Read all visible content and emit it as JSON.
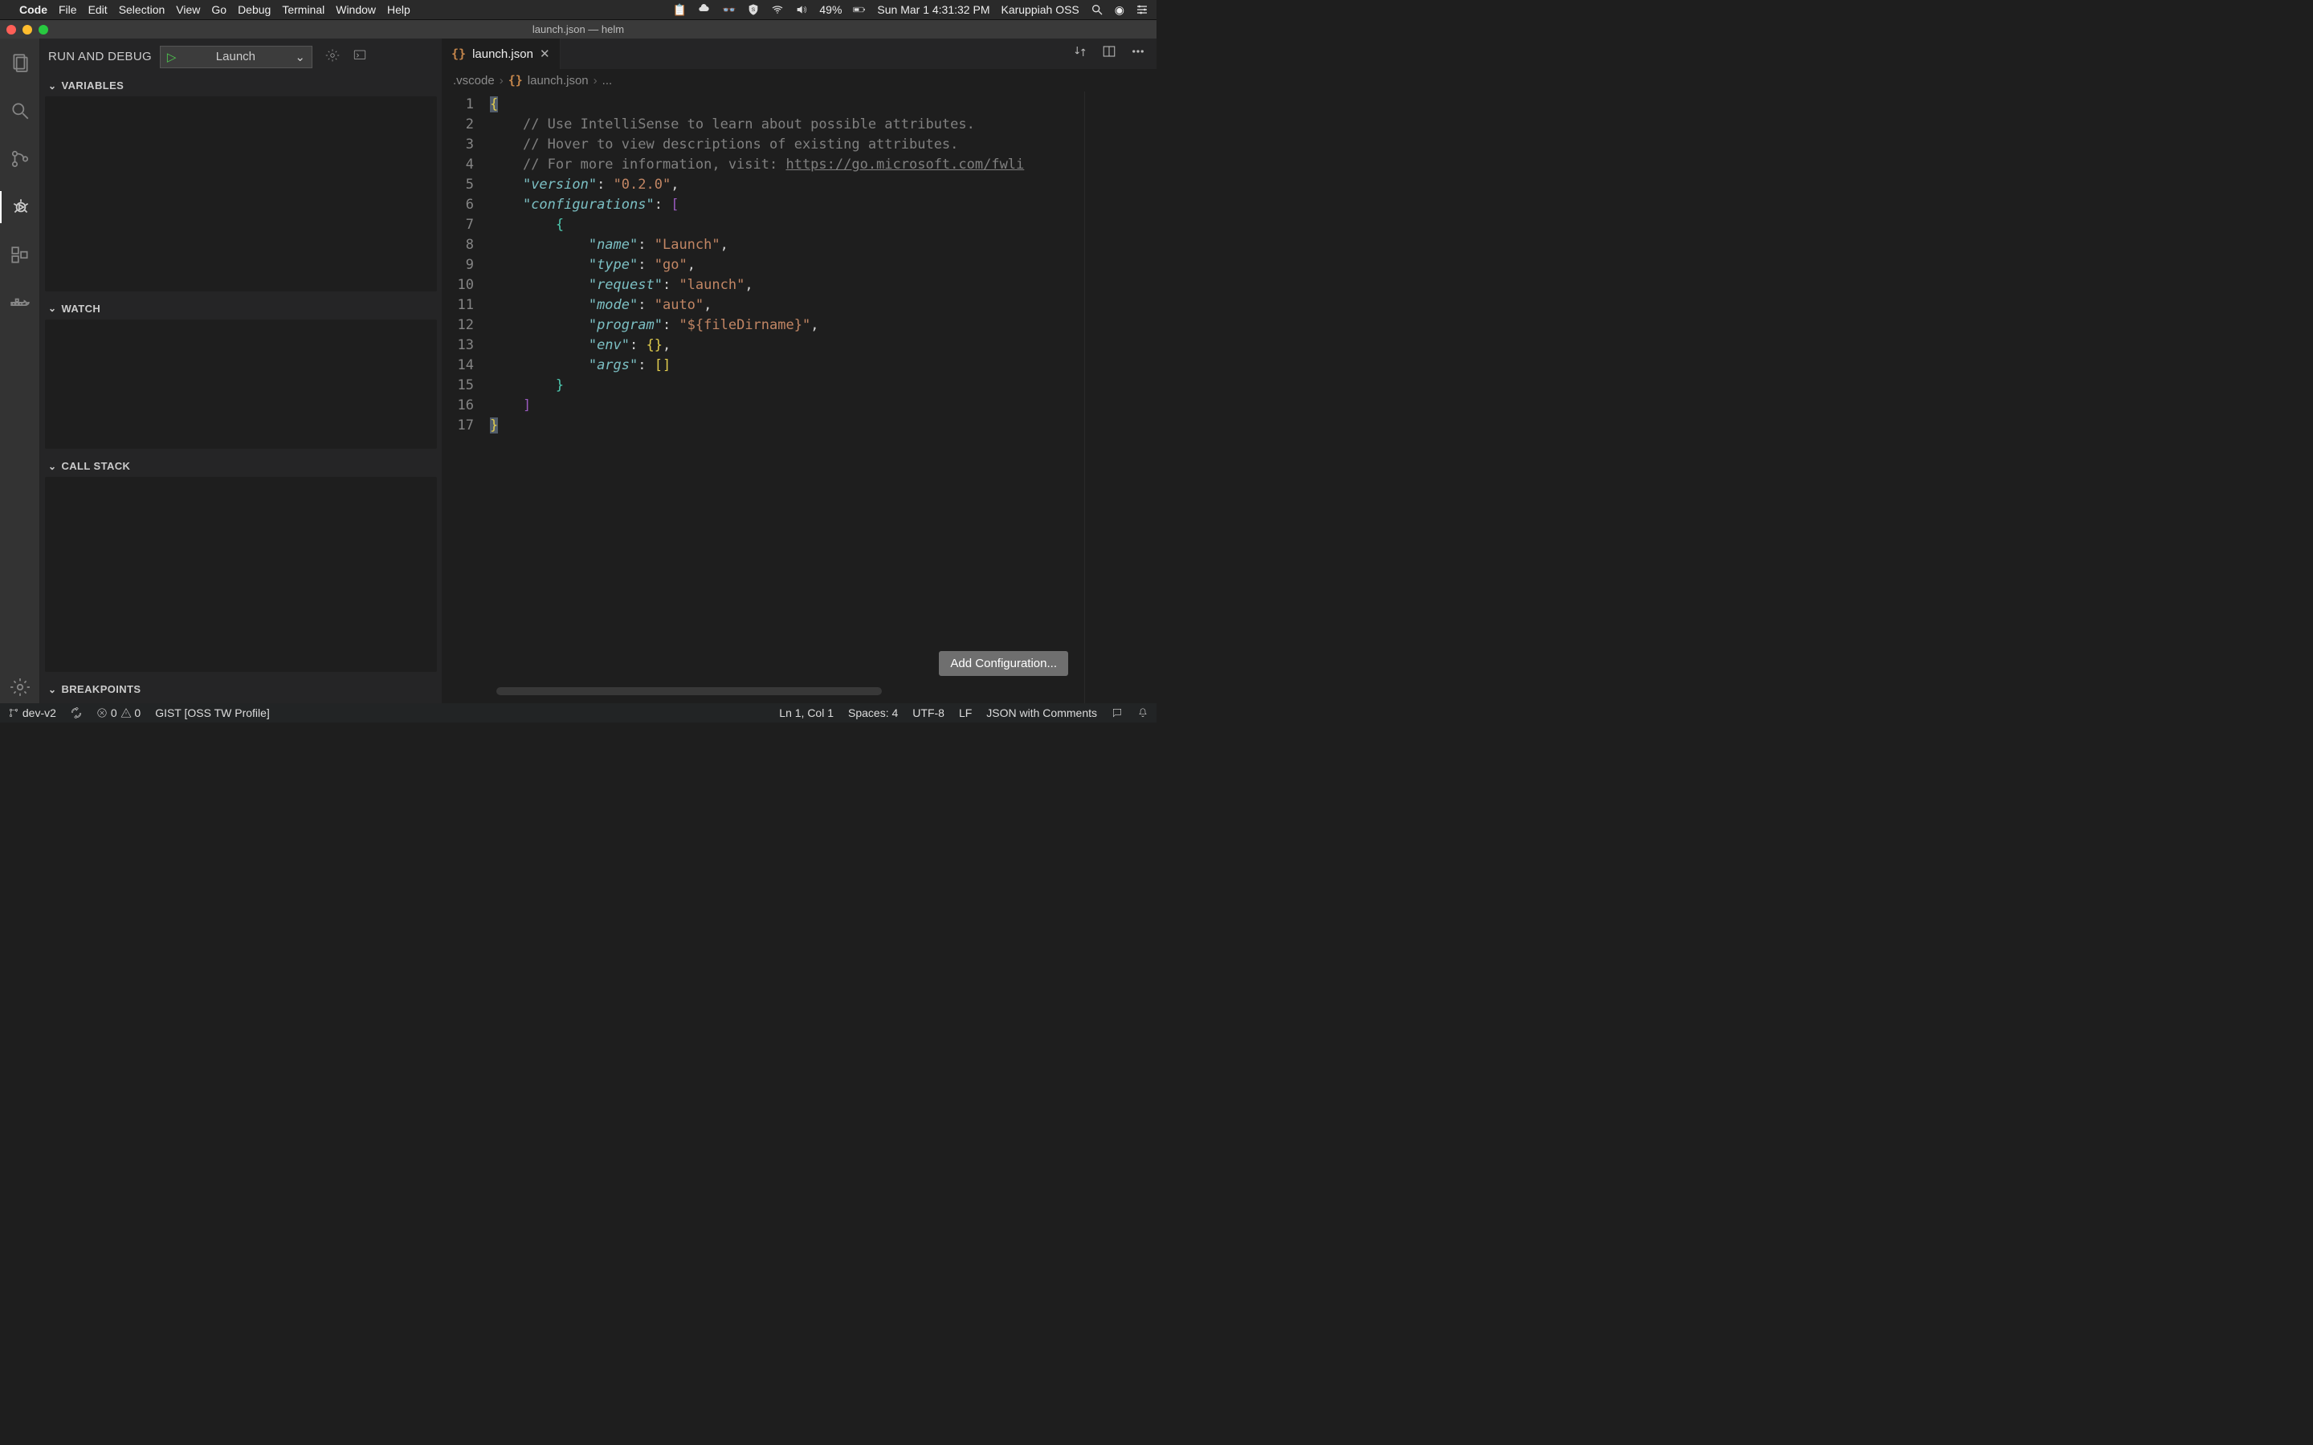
{
  "mac": {
    "appname": "Code",
    "menus": [
      "File",
      "Edit",
      "Selection",
      "View",
      "Go",
      "Debug",
      "Terminal",
      "Window",
      "Help"
    ],
    "battery": "49%",
    "datetime": "Sun Mar 1  4:31:32 PM",
    "user": "Karuppiah OSS"
  },
  "window": {
    "title": "launch.json — helm"
  },
  "sidebar": {
    "title": "RUN AND DEBUG",
    "config_selected": "Launch",
    "sections": {
      "variables": "VARIABLES",
      "watch": "WATCH",
      "callstack": "CALL STACK",
      "breakpoints": "BREAKPOINTS"
    }
  },
  "tab": {
    "filename": "launch.json"
  },
  "breadcrumbs": {
    "folder": ".vscode",
    "file": "launch.json",
    "tail": "..."
  },
  "code": {
    "lines": [
      {
        "n": 1,
        "indent": 0,
        "seg": [
          [
            "brace-hl",
            "{"
          ]
        ]
      },
      {
        "n": 2,
        "indent": 1,
        "seg": [
          [
            "comment",
            "// Use IntelliSense to learn about possible attributes."
          ]
        ]
      },
      {
        "n": 3,
        "indent": 1,
        "seg": [
          [
            "comment",
            "// Hover to view descriptions of existing attributes."
          ]
        ]
      },
      {
        "n": 4,
        "indent": 1,
        "seg": [
          [
            "comment",
            "// For more information, visit: "
          ],
          [
            "link",
            "https://go.microsoft.com/fwli"
          ]
        ]
      },
      {
        "n": 5,
        "indent": 1,
        "seg": [
          [
            "key",
            "\"version\""
          ],
          [
            "punc",
            ": "
          ],
          [
            "str",
            "\"0.2.0\""
          ],
          [
            "punc",
            ","
          ]
        ]
      },
      {
        "n": 6,
        "indent": 1,
        "seg": [
          [
            "key",
            "\"configurations\""
          ],
          [
            "punc",
            ": "
          ],
          [
            "bracket",
            "["
          ]
        ]
      },
      {
        "n": 7,
        "indent": 2,
        "seg": [
          [
            "brace-inner",
            "{"
          ]
        ]
      },
      {
        "n": 8,
        "indent": 3,
        "seg": [
          [
            "key",
            "\"name\""
          ],
          [
            "punc",
            ": "
          ],
          [
            "str",
            "\"Launch\""
          ],
          [
            "punc",
            ","
          ]
        ]
      },
      {
        "n": 9,
        "indent": 3,
        "seg": [
          [
            "key",
            "\"type\""
          ],
          [
            "punc",
            ": "
          ],
          [
            "str",
            "\"go\""
          ],
          [
            "punc",
            ","
          ]
        ]
      },
      {
        "n": 10,
        "indent": 3,
        "seg": [
          [
            "key",
            "\"request\""
          ],
          [
            "punc",
            ": "
          ],
          [
            "str",
            "\"launch\""
          ],
          [
            "punc",
            ","
          ]
        ]
      },
      {
        "n": 11,
        "indent": 3,
        "seg": [
          [
            "key",
            "\"mode\""
          ],
          [
            "punc",
            ": "
          ],
          [
            "str",
            "\"auto\""
          ],
          [
            "punc",
            ","
          ]
        ]
      },
      {
        "n": 12,
        "indent": 3,
        "seg": [
          [
            "key",
            "\"program\""
          ],
          [
            "punc",
            ": "
          ],
          [
            "str",
            "\"${fileDirname}\""
          ],
          [
            "punc",
            ","
          ]
        ]
      },
      {
        "n": 13,
        "indent": 3,
        "seg": [
          [
            "key",
            "\"env\""
          ],
          [
            "punc",
            ": "
          ],
          [
            "brace",
            "{}"
          ],
          [
            "punc",
            ","
          ]
        ]
      },
      {
        "n": 14,
        "indent": 3,
        "seg": [
          [
            "key",
            "\"args\""
          ],
          [
            "punc",
            ": "
          ],
          [
            "brace",
            "[]"
          ]
        ]
      },
      {
        "n": 15,
        "indent": 2,
        "seg": [
          [
            "brace-inner",
            "}"
          ]
        ]
      },
      {
        "n": 16,
        "indent": 1,
        "seg": [
          [
            "bracket",
            "]"
          ]
        ]
      },
      {
        "n": 17,
        "indent": 0,
        "seg": [
          [
            "brace-hl",
            "}"
          ]
        ]
      }
    ]
  },
  "editor_actions": {
    "add_config": "Add Configuration..."
  },
  "status": {
    "branch": "dev-v2",
    "errors": "0",
    "warnings": "0",
    "profile": "GIST [OSS TW Profile]",
    "position": "Ln 1, Col 1",
    "indent": "Spaces: 4",
    "encoding": "UTF-8",
    "eol": "LF",
    "language": "JSON with Comments"
  }
}
